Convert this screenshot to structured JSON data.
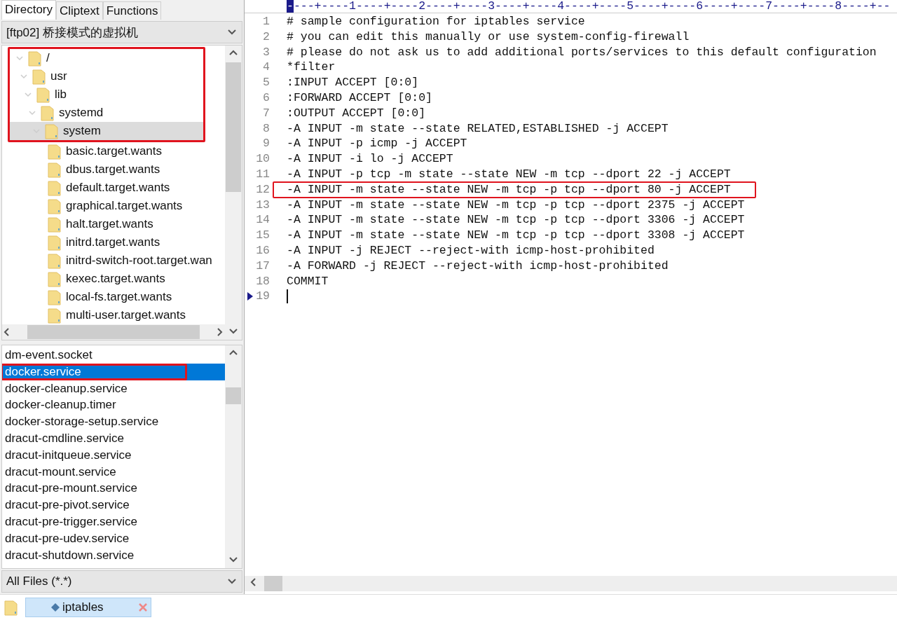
{
  "panel_tabs": [
    {
      "label": "Directory",
      "selected": true
    },
    {
      "label": "Cliptext",
      "selected": false
    },
    {
      "label": "Functions",
      "selected": false
    }
  ],
  "folder_select": {
    "value": "[ftp02] 桥接模式的虚拟机"
  },
  "tree": [
    {
      "label": "/",
      "expanded": true,
      "selected": false,
      "marked": true,
      "children": [
        {
          "label": "usr",
          "expanded": true,
          "selected": false,
          "marked": true,
          "children": [
            {
              "label": "lib",
              "expanded": true,
              "selected": false,
              "marked": true,
              "children": [
                {
                  "label": "systemd",
                  "expanded": true,
                  "selected": false,
                  "marked": true,
                  "children": [
                    {
                      "label": "system",
                      "expanded": true,
                      "selected": true,
                      "marked": true,
                      "children": [
                        {
                          "label": "basic.target.wants",
                          "selected": false,
                          "marked": false
                        },
                        {
                          "label": "dbus.target.wants",
                          "selected": false,
                          "marked": false
                        },
                        {
                          "label": "default.target.wants",
                          "selected": false,
                          "marked": false
                        },
                        {
                          "label": "graphical.target.wants",
                          "selected": false,
                          "marked": false
                        },
                        {
                          "label": "halt.target.wants",
                          "selected": false,
                          "marked": false
                        },
                        {
                          "label": "initrd.target.wants",
                          "selected": false,
                          "marked": false
                        },
                        {
                          "label": "initrd-switch-root.target.wan",
                          "selected": false,
                          "marked": false
                        },
                        {
                          "label": "kexec.target.wants",
                          "selected": false,
                          "marked": false
                        },
                        {
                          "label": "local-fs.target.wants",
                          "selected": false,
                          "marked": false
                        },
                        {
                          "label": "multi-user.target.wants",
                          "selected": false,
                          "marked": false
                        }
                      ]
                    }
                  ]
                }
              ]
            }
          ]
        }
      ]
    }
  ],
  "files": [
    {
      "name": "dm-event.socket",
      "selected": false,
      "marked": false
    },
    {
      "name": "docker.service",
      "selected": true,
      "marked": true
    },
    {
      "name": "docker-cleanup.service",
      "selected": false,
      "marked": false
    },
    {
      "name": "docker-cleanup.timer",
      "selected": false,
      "marked": false
    },
    {
      "name": "docker-storage-setup.service",
      "selected": false,
      "marked": false
    },
    {
      "name": "dracut-cmdline.service",
      "selected": false,
      "marked": false
    },
    {
      "name": "dracut-initqueue.service",
      "selected": false,
      "marked": false
    },
    {
      "name": "dracut-mount.service",
      "selected": false,
      "marked": false
    },
    {
      "name": "dracut-pre-mount.service",
      "selected": false,
      "marked": false
    },
    {
      "name": "dracut-pre-pivot.service",
      "selected": false,
      "marked": false
    },
    {
      "name": "dracut-pre-trigger.service",
      "selected": false,
      "marked": false
    },
    {
      "name": "dracut-pre-udev.service",
      "selected": false,
      "marked": false
    },
    {
      "name": "dracut-shutdown.service",
      "selected": false,
      "marked": false
    }
  ],
  "filter_select": {
    "value": "All Files (*.*)"
  },
  "editor": {
    "ruler": "----+----1----+----2----+----3----+----4----+----5----+----6----+----7----+----8----+--",
    "lines": [
      {
        "number": "1",
        "text": "# sample configuration for iptables service",
        "marked": false,
        "current": false
      },
      {
        "number": "2",
        "text": "# you can edit this manually or use system-config-firewall",
        "marked": false,
        "current": false
      },
      {
        "number": "3",
        "text": "# please do not ask us to add additional ports/services to this default configuration",
        "marked": false,
        "current": false
      },
      {
        "number": "4",
        "text": "*filter",
        "marked": false,
        "current": false
      },
      {
        "number": "5",
        "text": ":INPUT ACCEPT [0:0]",
        "marked": false,
        "current": false
      },
      {
        "number": "6",
        "text": ":FORWARD ACCEPT [0:0]",
        "marked": false,
        "current": false
      },
      {
        "number": "7",
        "text": ":OUTPUT ACCEPT [0:0]",
        "marked": false,
        "current": false
      },
      {
        "number": "8",
        "text": "-A INPUT -m state --state RELATED,ESTABLISHED -j ACCEPT",
        "marked": false,
        "current": false
      },
      {
        "number": "9",
        "text": "-A INPUT -p icmp -j ACCEPT",
        "marked": false,
        "current": false
      },
      {
        "number": "10",
        "text": "-A INPUT -i lo -j ACCEPT",
        "marked": false,
        "current": false
      },
      {
        "number": "11",
        "text": "-A INPUT -p tcp -m state --state NEW -m tcp --dport 22 -j ACCEPT",
        "marked": false,
        "current": false
      },
      {
        "number": "12",
        "text": "-A INPUT -m state --state NEW -m tcp -p tcp --dport 80 -j ACCEPT",
        "marked": true,
        "current": false
      },
      {
        "number": "13",
        "text": "-A INPUT -m state --state NEW -m tcp -p tcp --dport 2375 -j ACCEPT",
        "marked": false,
        "current": false
      },
      {
        "number": "14",
        "text": "-A INPUT -m state --state NEW -m tcp -p tcp --dport 3306 -j ACCEPT",
        "marked": false,
        "current": false
      },
      {
        "number": "15",
        "text": "-A INPUT -m state --state NEW -m tcp -p tcp --dport 3308 -j ACCEPT",
        "marked": false,
        "current": false
      },
      {
        "number": "16",
        "text": "-A INPUT -j REJECT --reject-with icmp-host-prohibited",
        "marked": false,
        "current": false
      },
      {
        "number": "17",
        "text": "-A FORWARD -j REJECT --reject-with icmp-host-prohibited",
        "marked": false,
        "current": false
      },
      {
        "number": "18",
        "text": "COMMIT",
        "marked": false,
        "current": false
      },
      {
        "number": "19",
        "marked": false,
        "current": true
      }
    ]
  },
  "document_tabs": [
    {
      "label": "iptables",
      "selected": true
    }
  ]
}
